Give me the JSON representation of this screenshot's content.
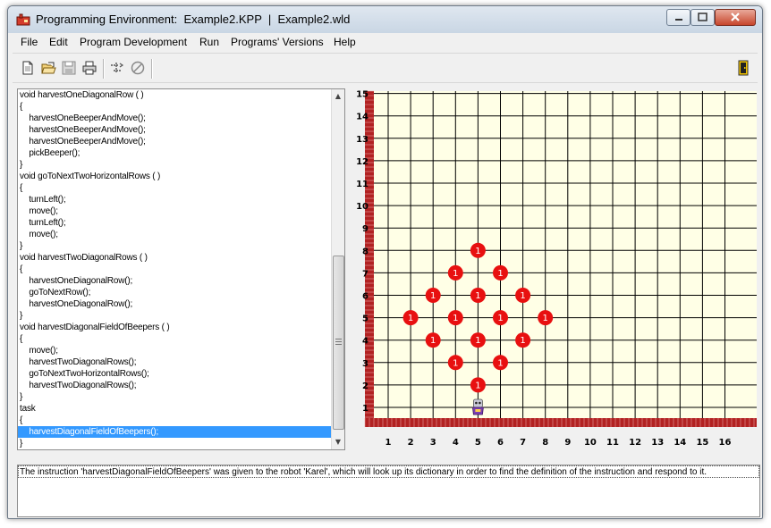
{
  "window": {
    "title": "Programming Environment:  Example2.KPP  |  Example2.wld"
  },
  "menu": [
    "File",
    "Edit",
    "Program Development",
    "Run",
    "Programs' Versions",
    "Help"
  ],
  "toolbar": {
    "icons": [
      "new-file-icon",
      "open-folder-icon",
      "save-icon",
      "print-icon",
      "compile-icon",
      "stop-icon",
      "exit-door-icon"
    ]
  },
  "code": {
    "lines": [
      "void harvestOneDiagonalRow ( )",
      "{",
      "    harvestOneBeeperAndMove();",
      "    harvestOneBeeperAndMove();",
      "    harvestOneBeeperAndMove();",
      "    pickBeeper();",
      "}",
      "void goToNextTwoHorizontalRows ( )",
      "{",
      "    turnLeft();",
      "    move();",
      "    turnLeft();",
      "    move();",
      "}",
      "void harvestTwoDiagonalRows ( )",
      "{",
      "    harvestOneDiagonalRow();",
      "    goToNextRow();",
      "    harvestOneDiagonalRow();",
      "}",
      "void harvestDiagonalFieldOfBeepers ( )",
      "{",
      "    move();",
      "    harvestTwoDiagonalRows();",
      "    goToNextTwoHorizontalRows();",
      "    harvestTwoDiagonalRows();",
      "}",
      "task",
      "{",
      "    harvestDiagonalFieldOfBeepers();",
      "}"
    ],
    "selected_line": 29
  },
  "world": {
    "streets": [
      "1",
      "2",
      "3",
      "4",
      "5",
      "6",
      "7",
      "8",
      "9",
      "10",
      "11",
      "12",
      "13",
      "14",
      "15"
    ],
    "avenues": [
      "1",
      "2",
      "3",
      "4",
      "5",
      "6",
      "7",
      "8",
      "9",
      "10",
      "11",
      "12",
      "13",
      "14",
      "15",
      "16"
    ],
    "beepers": [
      {
        "avenue": 5,
        "street": 2,
        "count": "1"
      },
      {
        "avenue": 4,
        "street": 3,
        "count": "1"
      },
      {
        "avenue": 6,
        "street": 3,
        "count": "1"
      },
      {
        "avenue": 3,
        "street": 4,
        "count": "1"
      },
      {
        "avenue": 5,
        "street": 4,
        "count": "1"
      },
      {
        "avenue": 7,
        "street": 4,
        "count": "1"
      },
      {
        "avenue": 2,
        "street": 5,
        "count": "1"
      },
      {
        "avenue": 4,
        "street": 5,
        "count": "1"
      },
      {
        "avenue": 6,
        "street": 5,
        "count": "1"
      },
      {
        "avenue": 8,
        "street": 5,
        "count": "1"
      },
      {
        "avenue": 3,
        "street": 6,
        "count": "1"
      },
      {
        "avenue": 5,
        "street": 6,
        "count": "1"
      },
      {
        "avenue": 7,
        "street": 6,
        "count": "1"
      },
      {
        "avenue": 4,
        "street": 7,
        "count": "1"
      },
      {
        "avenue": 6,
        "street": 7,
        "count": "1"
      },
      {
        "avenue": 5,
        "street": 8,
        "count": "1"
      }
    ],
    "robot": {
      "avenue": 5,
      "street": 1,
      "facing": "north"
    },
    "colors": {
      "background": "#ffffe6",
      "grid": "#000000",
      "wall": "#b22222",
      "beeper": "#e81010"
    }
  },
  "status": {
    "message": "The instruction 'harvestDiagonalFieldOfBeepers' was given to the robot 'Karel', which will look up its dictionary in order to find the definition of the instruction and respond to it."
  }
}
